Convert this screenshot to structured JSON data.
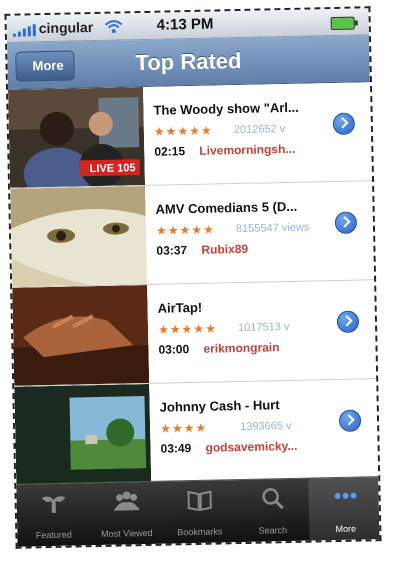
{
  "status_bar": {
    "carrier": "cingular",
    "time": "4:13 PM",
    "icons": [
      "signal-icon",
      "wifi-icon",
      "battery-icon"
    ]
  },
  "nav": {
    "back_label": "More",
    "title": "Top Rated"
  },
  "videos": [
    {
      "title": "The Woody show \"Arl...",
      "rating": "★★★★★",
      "views": "2012652 v",
      "duration": "02:15",
      "author": "Livemorningsh...",
      "thumb_text": "LIVE 105"
    },
    {
      "title": "AMV Comedians 5 (D...",
      "rating": "★★★★★",
      "views": "8155547 views",
      "duration": "03:37",
      "author": "Rubix89",
      "thumb_text": ""
    },
    {
      "title": "AirTap!",
      "rating": "★★★★★",
      "views": "1017513 v",
      "duration": "03:00",
      "author": "erikmongrain",
      "thumb_text": ""
    },
    {
      "title": "Johnny Cash - Hurt",
      "rating": "★★★★",
      "views": "1393665 v",
      "duration": "03:49",
      "author": "godsavemicky...",
      "thumb_text": ""
    }
  ],
  "tabs": [
    {
      "label": "Featured",
      "icon": "featured-icon",
      "active": false
    },
    {
      "label": "Most Viewed",
      "icon": "most-viewed-icon",
      "active": false
    },
    {
      "label": "Bookmarks",
      "icon": "bookmarks-icon",
      "active": false
    },
    {
      "label": "Search",
      "icon": "search-icon",
      "active": false
    },
    {
      "label": "More",
      "icon": "more-icon",
      "active": true
    }
  ],
  "colors": {
    "nav_bar": "#6f8db8",
    "star": "#e8792a",
    "author": "#c4413b",
    "disclosure": "#2a63c8",
    "tab_bar": "#1f1f1f"
  }
}
